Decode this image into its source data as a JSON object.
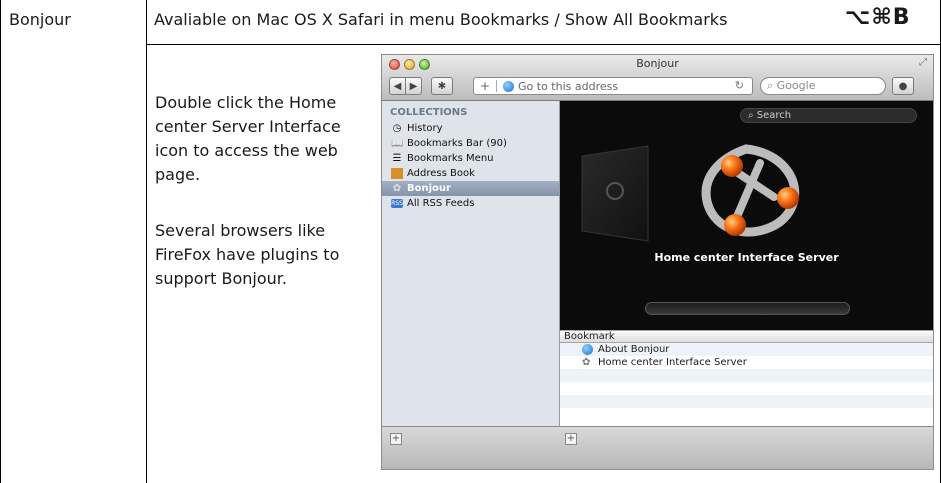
{
  "row": {
    "term": "Bonjour",
    "header_text": "Avaliable on Mac OS X Safari in menu Bookmarks / Show All Bookmarks",
    "shortcut": "⌥⌘B",
    "paragraph1": "Double click the Home center Server Interface icon to access the web page.",
    "paragraph2": "Several browsers like FireFox have plugins to support Bonjour."
  },
  "window": {
    "title": "Bonjour",
    "address_placeholder": "Go to this address",
    "search_placeholder": "Google",
    "sidebar": {
      "header": "COLLECTIONS",
      "items": [
        {
          "label": "History",
          "icon": "clock-icon"
        },
        {
          "label": "Bookmarks Bar (90)",
          "icon": "book-icon"
        },
        {
          "label": "Bookmarks Menu",
          "icon": "menu-icon"
        },
        {
          "label": "Address Book",
          "icon": "address-book-icon"
        },
        {
          "label": "Bonjour",
          "icon": "bonjour-icon",
          "selected": true
        },
        {
          "label": "All RSS Feeds",
          "icon": "rss-icon"
        }
      ]
    },
    "cover_flow": {
      "search_placeholder": "Search",
      "caption": "Home center Interface Server"
    },
    "list": {
      "column_header": "Bookmark",
      "rows": [
        {
          "label": "About Bonjour",
          "icon": "globe-icon"
        },
        {
          "label": "Home center Interface Server",
          "icon": "bonjour-icon"
        }
      ]
    }
  },
  "colors": {
    "selection": "#8d9cb3",
    "cover_background": "#0b0b0b",
    "bonjour_orange": "#e85a10"
  }
}
